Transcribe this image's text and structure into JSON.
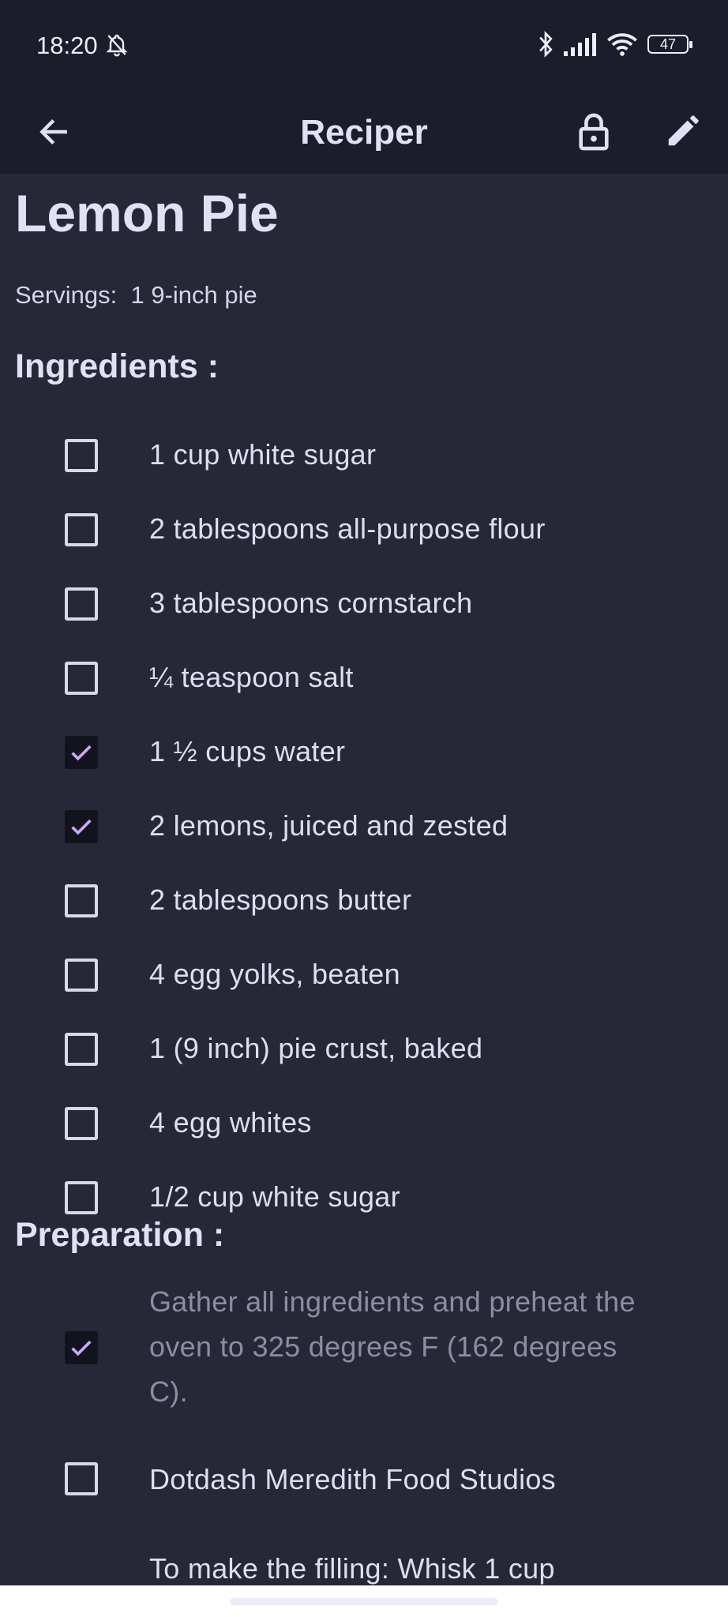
{
  "status_bar": {
    "time": "18:20",
    "battery": "47"
  },
  "app_bar": {
    "title": "Reciper"
  },
  "recipe": {
    "title": "Lemon Pie",
    "servings_label": "Servings:",
    "servings_value": "1 9-inch pie"
  },
  "ingredients": {
    "heading": "Ingredients :",
    "items": [
      {
        "text": "1 cup white sugar",
        "checked": false
      },
      {
        "text": "2 tablespoons all-purpose flour",
        "checked": false
      },
      {
        "text": "3 tablespoons cornstarch",
        "checked": false
      },
      {
        "text": "¼ teaspoon salt",
        "checked": false
      },
      {
        "text": "1 ½ cups water",
        "checked": true
      },
      {
        "text": "2 lemons, juiced and zested",
        "checked": true
      },
      {
        "text": "2 tablespoons butter",
        "checked": false
      },
      {
        "text": "4 egg yolks, beaten",
        "checked": false
      },
      {
        "text": "1 (9 inch) pie crust, baked",
        "checked": false
      },
      {
        "text": "4 egg whites",
        "checked": false
      },
      {
        "text": "1/2 cup white sugar",
        "checked": false
      }
    ]
  },
  "preparation": {
    "heading": "Preparation :",
    "steps": [
      {
        "text": "Gather all ingredients and preheat the oven to 325 degrees F (162 degrees C).",
        "checked": true
      },
      {
        "text": "Dotdash Meredith Food Studios",
        "checked": false
      },
      {
        "text": "To make the filling: Whisk 1 cup",
        "checked": false
      }
    ]
  },
  "colors": {
    "accent_check": "#c9a8f5",
    "background": "#262838",
    "app_bar": "#1b1d2a"
  },
  "icons": {
    "back": "arrow-left-icon",
    "lock": "lock-open-icon",
    "edit": "pencil-icon",
    "bell": "bell-off-icon",
    "bluetooth": "bluetooth-icon",
    "signal": "signal-icon",
    "wifi": "wifi-icon",
    "battery": "battery-icon"
  }
}
